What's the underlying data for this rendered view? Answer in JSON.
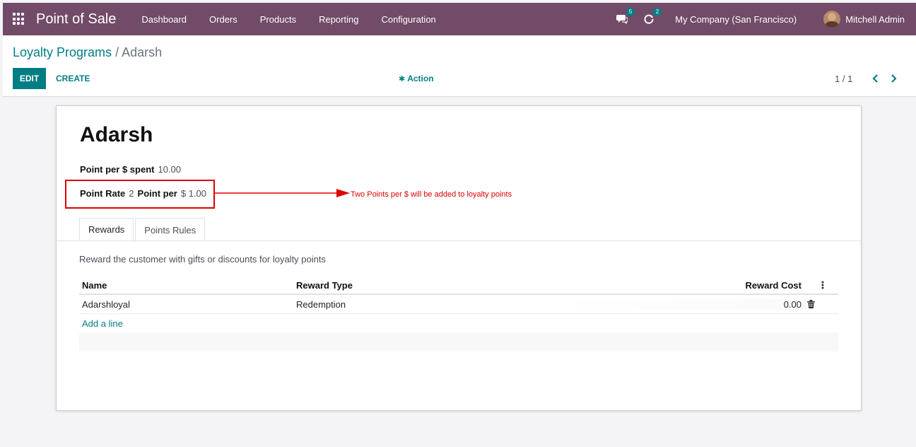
{
  "navbar": {
    "app_title": "Point of Sale",
    "menu": [
      "Dashboard",
      "Orders",
      "Products",
      "Reporting",
      "Configuration"
    ],
    "messages_count": "5",
    "activities_count": "2",
    "company": "My Company (San Francisco)",
    "user": "Mitchell Admin"
  },
  "breadcrumb": {
    "parent": "Loyalty Programs",
    "separator": "/",
    "current": "Adarsh"
  },
  "toolbar": {
    "edit_label": "EDIT",
    "create_label": "CREATE",
    "action_label": "Action",
    "pager": "1 / 1"
  },
  "form": {
    "title": "Adarsh",
    "point_per_spent_label": "Point per $ spent",
    "point_per_spent_value": "10.00",
    "point_rate_label": "Point Rate",
    "point_rate_value": "2",
    "point_per_label": "Point per",
    "point_per_value": "$ 1.00",
    "annotation": "Two Points per $ will be added to loyalty points",
    "annotation_color": "#dd0000"
  },
  "tabs": [
    "Rewards",
    "Points Rules"
  ],
  "rewards": {
    "description": "Reward the customer with gifts or discounts for loyalty points",
    "columns": [
      "Name",
      "Reward Type",
      "Reward Cost"
    ],
    "rows": [
      {
        "name": "Adarshloyal",
        "type": "Redemption",
        "cost": "0.00"
      }
    ],
    "add_line_label": "Add a line"
  },
  "colors": {
    "navbar": "#714b67",
    "accent": "#017e84"
  }
}
